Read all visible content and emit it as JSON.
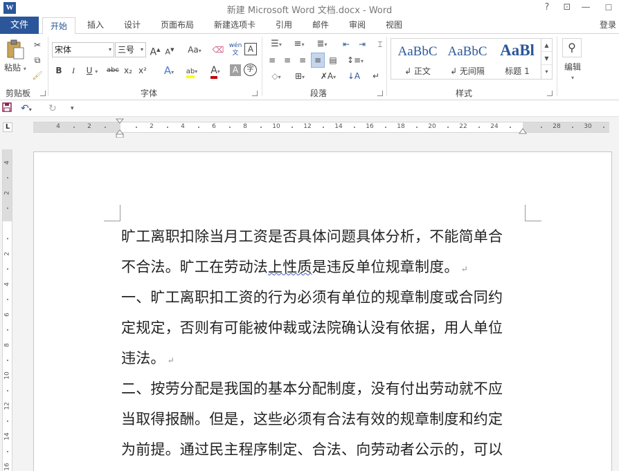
{
  "app": {
    "title": "新建 Microsoft Word 文档.docx - Word",
    "logo_letter": "W",
    "help": "?",
    "restore": "⊡",
    "minimize": "—",
    "maximize": "☐",
    "close": "✕"
  },
  "tabs": {
    "file": "文件",
    "home": "开始",
    "insert": "插入",
    "design": "设计",
    "layout": "页面布局",
    "custom": "新建选项卡",
    "references": "引用",
    "mailings": "邮件",
    "review": "审阅",
    "view": "视图",
    "login": "登录"
  },
  "ribbon": {
    "clipboard": {
      "paste": "粘贴",
      "label": "剪贴板"
    },
    "font": {
      "font_name": "宋体",
      "font_size": "三号",
      "label": "字体",
      "bold": "B",
      "italic": "I",
      "underline": "U",
      "strikethrough": "abc",
      "subscript": "x₂",
      "superscript": "x²",
      "grow": "A",
      "shrink": "A",
      "change_case": "Aa",
      "phonetic": "wén\n文",
      "char_border": "A",
      "text_effects": "A",
      "highlight": "ab",
      "font_color": "A",
      "char_shading": "A",
      "enclose": "字"
    },
    "paragraph": {
      "label": "段落"
    },
    "styles": {
      "label": "样式",
      "items": [
        {
          "sample": "AaBbC",
          "name": "↲ 正文"
        },
        {
          "sample": "AaBbC",
          "name": "↲ 无间隔"
        },
        {
          "sample": "AaBl",
          "name": "标题 1"
        }
      ]
    },
    "editing": {
      "label": "编辑"
    }
  },
  "ruler": {
    "tab_selector": "L",
    "numbers": [
      "4",
      "2",
      "",
      "2",
      "4",
      "6",
      "8",
      "10",
      "12",
      "14",
      "16",
      "18",
      "20",
      "22",
      "24",
      "",
      "28",
      "30"
    ],
    "v_numbers": [
      "4",
      "2",
      "",
      "2",
      "4",
      "6",
      "8",
      "10",
      "12",
      "14",
      "16"
    ]
  },
  "document": {
    "paragraphs": [
      {
        "lines": [
          "旷工离职扣除当月工资是否具体问题具体分析，不能简单合",
          "不合法。旷工在劳动法上性质是违反单位规章制度。"
        ]
      },
      {
        "lines": [
          "一、旷工离职扣工资的行为必须有单位的规章制度或合同约",
          "定规定，否则有可能被仲裁或法院确认没有依据，用人单位",
          "违法。"
        ]
      },
      {
        "lines": [
          "二、按劳分配是我国的基本分配制度，没有付出劳动就不应",
          "当取得报酬。但是，这些必须有合法有效的规章制度和约定",
          "为前提。通过民主程序制定、合法、向劳动者公示的，可以"
        ]
      }
    ],
    "line2_prefix": "不合法。旷工在劳动法",
    "line2_squiggle": "上性质",
    "line2_suffix": "是违反单位规章制度。",
    "para_mark": "↵"
  },
  "colors": {
    "accent": "#2b579a",
    "highlight_yellow": "#ffff00",
    "font_red": "#c00000"
  }
}
